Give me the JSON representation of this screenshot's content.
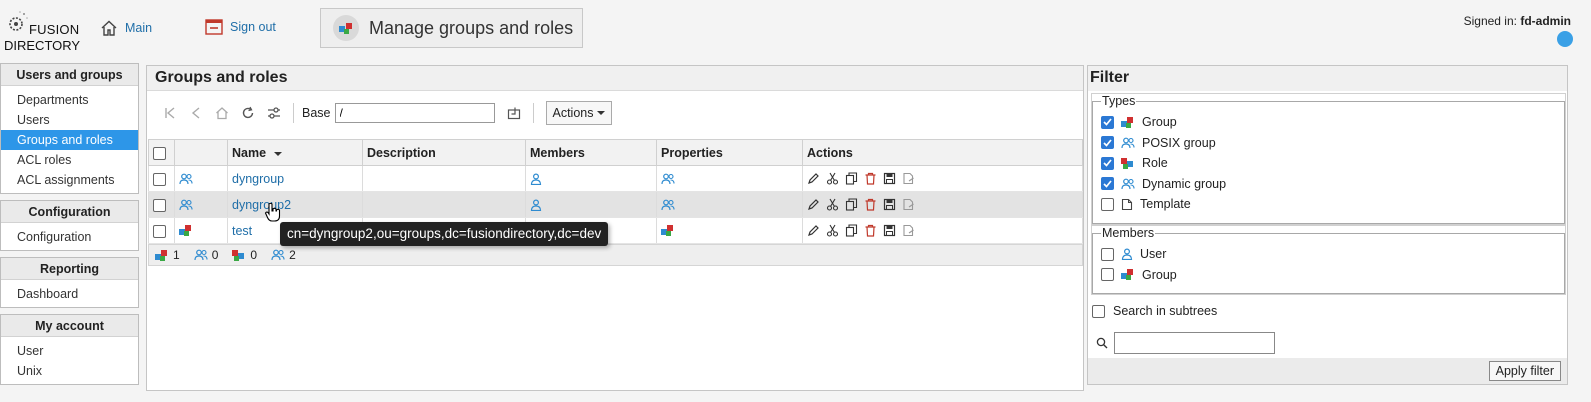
{
  "header": {
    "logo_line1": "FUSION",
    "logo_line2": "DIRECTORY",
    "main_link": "Main",
    "signout_link": "Sign out",
    "page_title": "Manage groups and roles",
    "signed_in_label": "Signed in:",
    "signed_in_user": "fd-admin"
  },
  "sidebar": {
    "groups": [
      {
        "title": "Users and groups",
        "items": [
          "Departments",
          "Users",
          "Groups and roles",
          "ACL roles",
          "ACL assignments"
        ],
        "active": "Groups and roles"
      },
      {
        "title": "Configuration",
        "items": [
          "Configuration"
        ]
      },
      {
        "title": "Reporting",
        "items": [
          "Dashboard"
        ]
      },
      {
        "title": "My account",
        "items": [
          "User",
          "Unix"
        ]
      }
    ]
  },
  "main": {
    "title": "Groups and roles",
    "toolbar": {
      "base_label": "Base",
      "base_value": "/",
      "actions_label": "Actions"
    },
    "columns": [
      "Name",
      "Description",
      "Members",
      "Properties",
      "Actions"
    ],
    "rows": [
      {
        "name": "dyngroup",
        "description": "",
        "type_icon": "dynamic-group-icon"
      },
      {
        "name": "dyngroup2",
        "description": "",
        "type_icon": "dynamic-group-icon"
      },
      {
        "name": "test",
        "description": "",
        "type_icon": "group-icon"
      }
    ],
    "summary": {
      "groups": "1",
      "posix_groups": "0",
      "roles": "0",
      "dynamic_groups": "2"
    },
    "tooltip": "cn=dyngroup2,ou=groups,dc=fusiondirectory,dc=dev"
  },
  "filter": {
    "title": "Filter",
    "types_legend": "Types",
    "types": [
      {
        "label": "Group",
        "checked": true
      },
      {
        "label": "POSIX group",
        "checked": true
      },
      {
        "label": "Role",
        "checked": true
      },
      {
        "label": "Dynamic group",
        "checked": true
      },
      {
        "label": "Template",
        "checked": false
      }
    ],
    "members_legend": "Members",
    "members": [
      {
        "label": "User",
        "checked": false
      },
      {
        "label": "Group",
        "checked": false
      }
    ],
    "subtree_label": "Search in subtrees",
    "apply_label": "Apply filter"
  },
  "colors": {
    "accent": "#2d96e8",
    "link": "#1f6ea8",
    "status": "#3aa0e6"
  }
}
